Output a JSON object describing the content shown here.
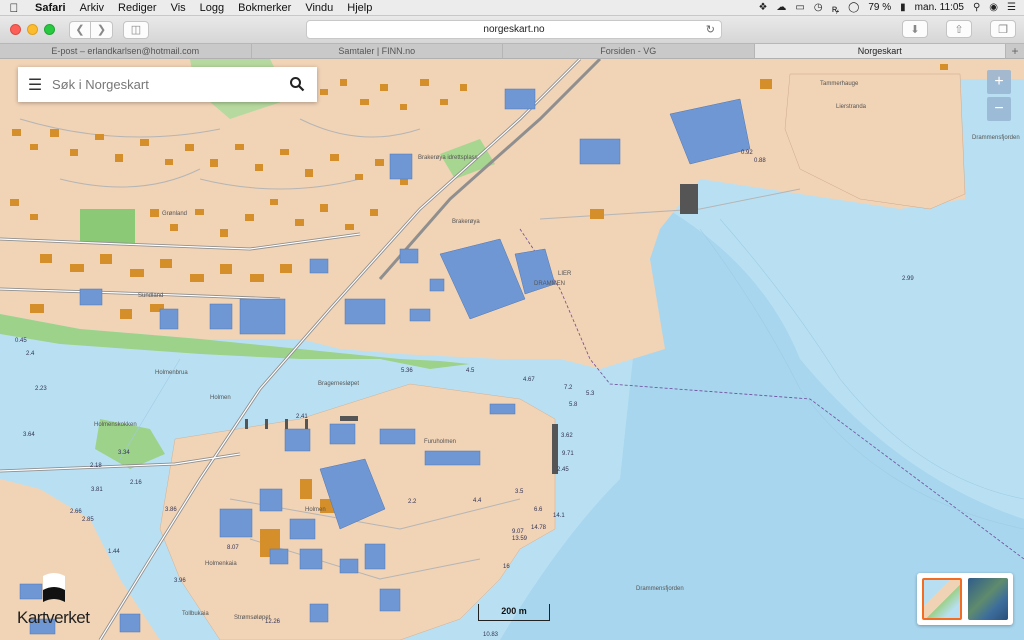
{
  "menubar": {
    "app": "Safari",
    "items": [
      "Arkiv",
      "Rediger",
      "Vis",
      "Logg",
      "Bokmerker",
      "Vindu",
      "Hjelp"
    ],
    "battery": "79 %",
    "clock": "man. 11:05"
  },
  "toolbar": {
    "url": "norgeskart.no"
  },
  "tabs": [
    {
      "label": "E-post – erlandkarlsen@hotmail.com"
    },
    {
      "label": "Samtaler | FINN.no"
    },
    {
      "label": "Forsiden - VG"
    },
    {
      "label": "Norgeskart"
    }
  ],
  "search": {
    "placeholder": "Søk i Norgeskart"
  },
  "zoom": {
    "in": "+",
    "out": "−"
  },
  "scale": {
    "label": "200 m"
  },
  "logo": {
    "text": "Kartverket"
  },
  "map_labels": {
    "l0": "Lierstranda",
    "l1": "Drammensfjorden",
    "l2": "Drammensfjorden",
    "l3": "Holmenbrua",
    "l4": "Holmen",
    "l5": "Holmenkaia",
    "l6": "Tollbukaia",
    "l7": "Strømsøløpet",
    "l8": "Bragernesløpet",
    "l9": "Brakerøya",
    "l10": "LIER",
    "l11": "DRAMMEN",
    "l12": "Furuholmen",
    "l13": "Holmenskokken",
    "l14": "Holmen",
    "l15": "Brakerøya idrettsplass",
    "l16": "Grønland",
    "l17": "Sundland",
    "l18": "Tammerhauge",
    "d0": "0.92",
    "d1": "0.88",
    "d2": "2.99",
    "d3": "5.36",
    "d4": "4.5",
    "d5": "4.67",
    "d6": "7.2",
    "d7": "5.3",
    "d8": "5.8",
    "d9": "3.62",
    "d10": "9.71",
    "d11": "2.45",
    "d12": "14.1",
    "d13": "14.78",
    "d14": "13.59",
    "d15": "9.07",
    "d16": "10.83",
    "d17": "12.26",
    "d18": "3.96",
    "d19": "8.07",
    "d20": "2.23",
    "d21": "3.64",
    "d22": "3.34",
    "d23": "2.66",
    "d24": "2.85",
    "d25": "1.44",
    "d26": "0.45",
    "d27": "2.4",
    "d28": "3.86",
    "d29": "2.16",
    "d30": "2.18",
    "d31": "3.81",
    "d32": "2.41",
    "d33": "4.4",
    "d34": "3.5",
    "d35": "2.2",
    "d36": "16",
    "d37": "6.6"
  }
}
